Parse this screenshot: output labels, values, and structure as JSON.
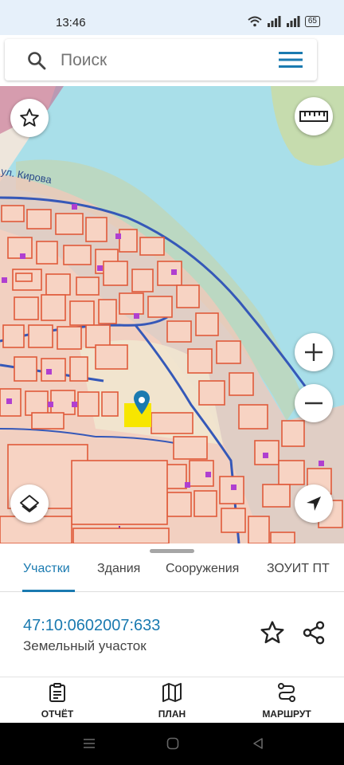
{
  "status": {
    "time": "13:46",
    "battery": "65"
  },
  "search": {
    "placeholder": "Поиск"
  },
  "map": {
    "street_label": "ул. Кирова",
    "marker_color": "#1a7ab0",
    "selected_parcel_color": "#f7e600"
  },
  "tabs": [
    {
      "label": "Участки",
      "active": true
    },
    {
      "label": "Здания",
      "active": false
    },
    {
      "label": "Сооружения",
      "active": false
    },
    {
      "label": "ЗОУИТ ПТ",
      "active": false
    }
  ],
  "parcel": {
    "number": "47:10:0602007:633",
    "type": "Земельный участок"
  },
  "bottom_nav": [
    {
      "label": "ОТЧЁТ",
      "icon": "report-icon"
    },
    {
      "label": "ПЛАН",
      "icon": "map-plan-icon"
    },
    {
      "label": "МАРШРУТ",
      "icon": "route-icon"
    }
  ],
  "colors": {
    "accent": "#1a7ab0",
    "water": "#a9dfe9",
    "parcel_border": "#e05a3a",
    "parcel_fill": "#f7d3c3"
  }
}
